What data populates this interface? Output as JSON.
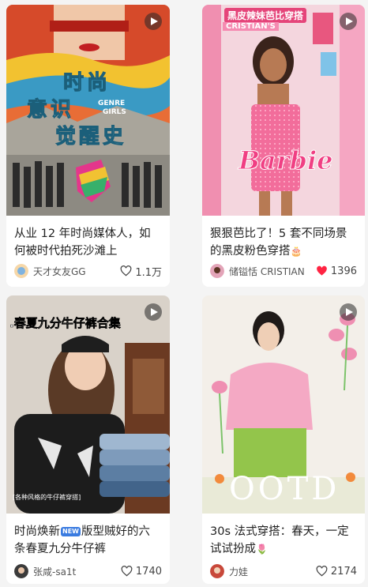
{
  "cards": [
    {
      "cover_text": {
        "headline_1": "时尚",
        "headline_2": "意识",
        "headline_3": "觉醒史",
        "tag_1": "GENRE",
        "tag_2": "GIRLS"
      },
      "title": "从业 12 年时尚媒体人，如何被时代拍死沙滩上",
      "author": "天才女友GG",
      "likes": "1.1万",
      "liked": false
    },
    {
      "cover_text": {
        "headline": "黑皮辣妹芭比穿搭",
        "brand": "CRISTIAN'S",
        "script": "Barbie"
      },
      "title": "狠狠芭比了！5 套不同场景的黑皮粉色穿搭",
      "title_emoji": "🎂",
      "author": "储镒恬 CRISTIAN",
      "likes": "1396",
      "liked": true
    },
    {
      "cover_text": {
        "headline": ".春夏九分牛仔裤合集",
        "caption": "[各种风格的牛仔裤穿搭]"
      },
      "title_part1": "时尚焕新",
      "title_badge": "NEW",
      "title_part2": "版型贼好的六条春夏九分牛仔裤",
      "author": "张咸-sa1t",
      "likes": "1740",
      "liked": false
    },
    {
      "cover_text": {
        "headline": "OOTD"
      },
      "title": "30s 法式穿搭：春天，一定试试扮成",
      "title_emoji": "🌷",
      "author": "力娃",
      "likes": "2174",
      "liked": false
    }
  ],
  "icons": {
    "play": "play-icon",
    "like": "heart-outline-icon",
    "liked": "heart-filled-icon"
  },
  "colors": {
    "liked_heart": "#ff2442",
    "text": "#222222",
    "muted": "#555555"
  }
}
